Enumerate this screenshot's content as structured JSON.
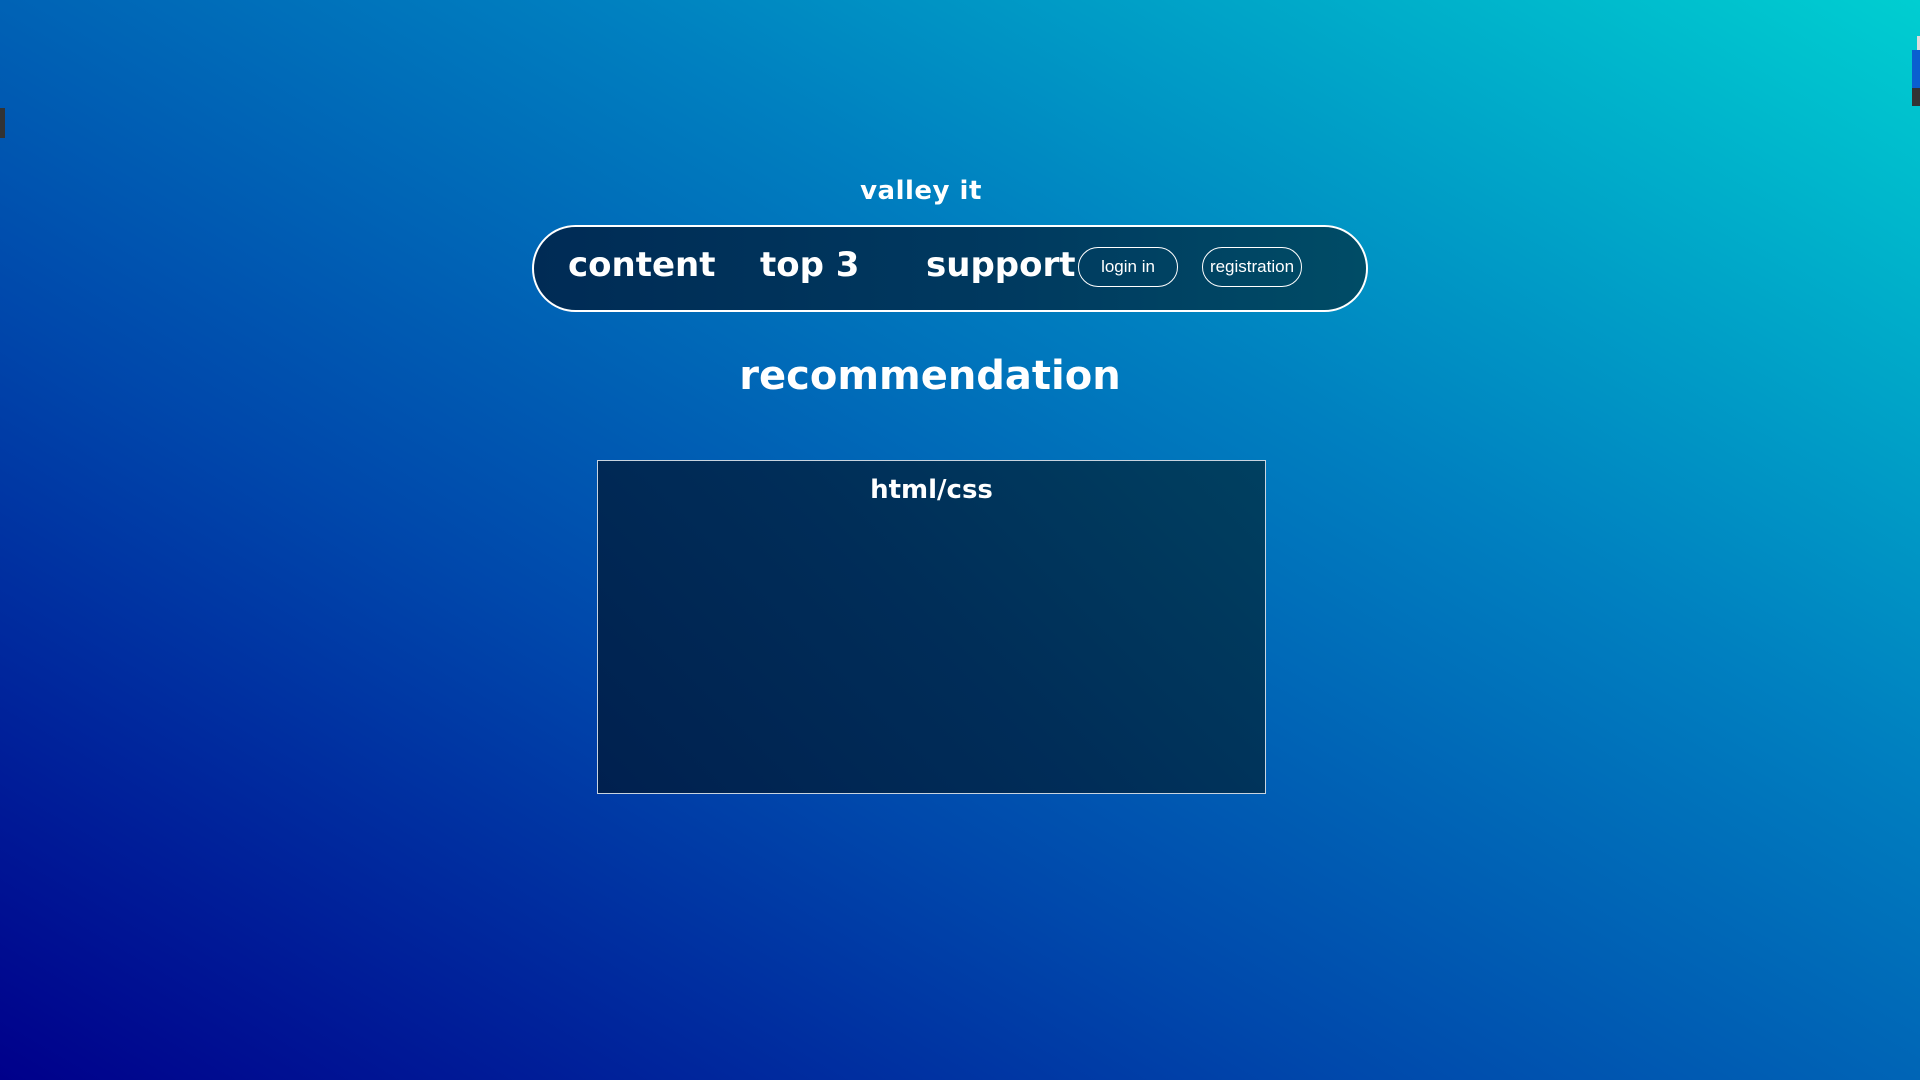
{
  "header": {
    "site_title": "valley it"
  },
  "nav": {
    "links": [
      {
        "label": "content"
      },
      {
        "label": "top 3"
      },
      {
        "label": "support"
      }
    ],
    "login_label": "login in",
    "registration_label": "registration"
  },
  "main": {
    "section_title": "recommendation",
    "cards": [
      {
        "title": "html/css"
      }
    ]
  },
  "colors": {
    "background_gradient": [
      "#00008b",
      "#0047ab",
      "#0080c0",
      "#00ced1"
    ],
    "panel_dark": "#002b55",
    "text": "#ffffff"
  }
}
